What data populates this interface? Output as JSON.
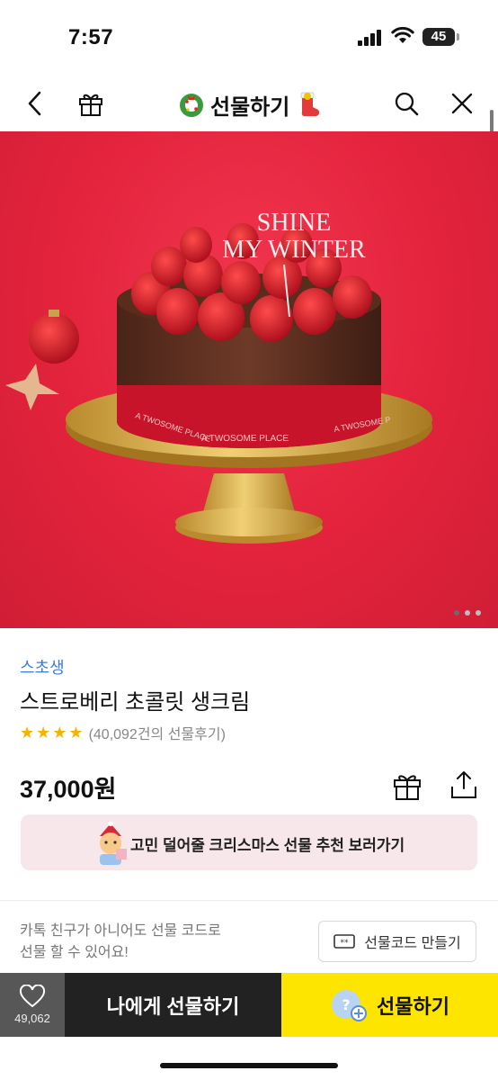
{
  "status_bar": {
    "time": "7:57",
    "battery": "45"
  },
  "nav": {
    "title": "선물하기"
  },
  "hero": {
    "topper_line1": "SHINE",
    "topper_line2": "MY WINTER",
    "ribbon_text": "A TWOSOME PLACE",
    "ribbon_text_right": "A TWOSOME P"
  },
  "product": {
    "brand": "스초생",
    "name": "스트로베리 초콜릿 생크림",
    "rating_stars": 4,
    "review_text": "(40,092건의 선물후기)",
    "price": "37,000원"
  },
  "banner": {
    "text": "고민 덜어줄 크리스마스 선물 추천 보러가기"
  },
  "gift_code": {
    "info_line1": "카톡 친구가 아니어도 선물 코드로",
    "info_line2": "선물 할 수 있어요!",
    "button_label": "선물코드 만들기"
  },
  "bottom_bar": {
    "like_count": "49,062",
    "self_gift_label": "나에게 선물하기",
    "gift_label": "선물하기"
  },
  "colors": {
    "brand_yellow": "#fee500",
    "brand_blue": "#3e7bd6",
    "hero_red": "#e3233c",
    "star": "#f5b400"
  }
}
